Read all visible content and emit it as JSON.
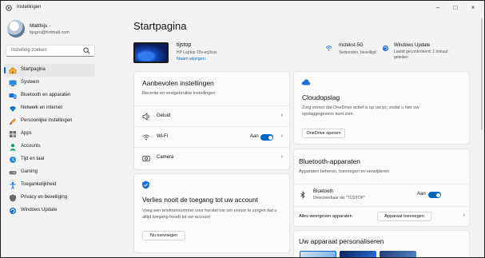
{
  "window": {
    "title": "Instellingen"
  },
  "user": {
    "name": "Matthijs -",
    "email": "tijsgro@hotmail.com"
  },
  "search": {
    "placeholder": "Instelling zoeken"
  },
  "nav": [
    {
      "label": "Startpagina",
      "icon": "home-icon"
    },
    {
      "label": "Systeem",
      "icon": "monitor-icon"
    },
    {
      "label": "Bluetooth en apparaten",
      "icon": "bluetooth-devices-icon"
    },
    {
      "label": "Netwerk en internet",
      "icon": "network-icon"
    },
    {
      "label": "Persoonlijke instellingen",
      "icon": "brush-icon"
    },
    {
      "label": "Apps",
      "icon": "apps-icon"
    },
    {
      "label": "Accounts",
      "icon": "account-icon"
    },
    {
      "label": "Tijd en taal",
      "icon": "globe-clock-icon"
    },
    {
      "label": "Gaming",
      "icon": "gamepad-icon"
    },
    {
      "label": "Toegankelijkheid",
      "icon": "accessibility-icon"
    },
    {
      "label": "Privacy en beveiliging",
      "icon": "shield-icon"
    },
    {
      "label": "Windows Update",
      "icon": "windows-update-icon"
    }
  ],
  "page": {
    "title": "Startpagina"
  },
  "device": {
    "name": "tijstop",
    "model": "HP Laptop 15s-eq3xxx",
    "rename": "Naam wijzigen"
  },
  "status": {
    "wifi": {
      "title": "mctekst-5G",
      "sub": "Verbonden, beveiligd"
    },
    "update": {
      "title": "Windows Update",
      "sub1": "Laatst gecontroleerd: 1 minuut",
      "sub2": "geleden"
    }
  },
  "recommended": {
    "title": "Aanbevolen instellingen",
    "sub": "Recente en veelgebruikte instellingen",
    "rows": [
      {
        "label": "Geluid",
        "icon": "speaker-icon"
      },
      {
        "label": "Wi-Fi",
        "icon": "wifi-icon",
        "toggle_label": "Aan"
      },
      {
        "label": "Camera",
        "icon": "camera-icon"
      }
    ]
  },
  "account": {
    "title": "Verlies nooit de toegang tot uw account",
    "sub1": "Voeg een telefoonnummer voor herstel toe om ervoor te zorgen dat u",
    "sub2": "altijd toegang houdt tot uw account",
    "button": "Nu toevoegen"
  },
  "cloud": {
    "title": "Cloudopslag",
    "sub1": "Zorg ervoor dat OneDrive actief is op uw pc, zodat u hier uw",
    "sub2": "opslaggegevens kunt zien.",
    "button": "OneDrive openen"
  },
  "bluetooth": {
    "title": "Bluetooth-apparaten",
    "sub": "Apparaten beheren, toevoegen en verwijderen",
    "row_title": "Bluetooth",
    "row_sub": "Detecteerbaar als \"TIJSTOP\"",
    "toggle_label": "Aan",
    "all_label": "Alles weergeven apparaten",
    "add_button": "Apparaat toevoegen"
  },
  "personalize": {
    "title": "Uw apparaat personaliseren"
  },
  "colors": {
    "accent": "#0067c0",
    "background": "#f3f3f3",
    "card": "#fbfbfb"
  }
}
